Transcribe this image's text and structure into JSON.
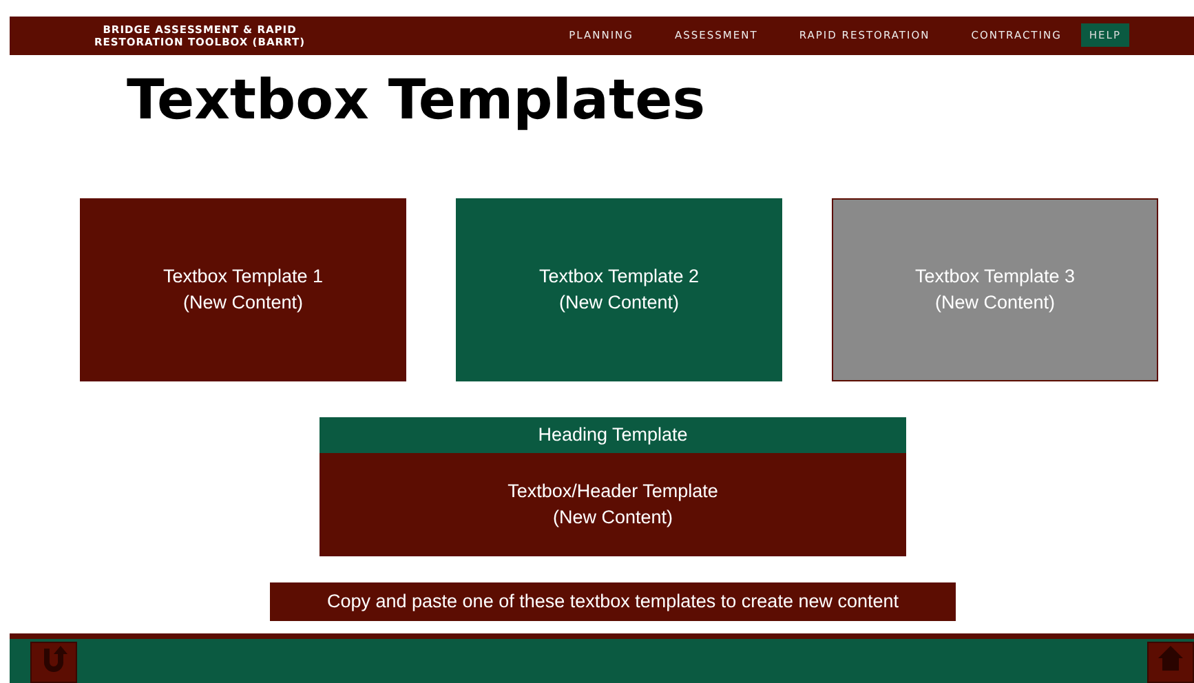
{
  "header": {
    "title_line_1": "BRIDGE ASSESSMENT & RAPID",
    "title_line_2": "RESTORATION TOOLBOX (BARRT)",
    "nav": [
      {
        "label": "PLANNING",
        "kind": "link"
      },
      {
        "label": "ASSESSMENT",
        "kind": "link"
      },
      {
        "label": "RAPID RESTORATION",
        "kind": "link"
      },
      {
        "label": "CONTRACTING",
        "kind": "link"
      },
      {
        "label": "HELP",
        "kind": "button"
      }
    ]
  },
  "page_title": "Textbox Templates",
  "templates": [
    {
      "line_1": "Textbox Template 1",
      "line_2": "(New Content)",
      "color": "#5c0d02"
    },
    {
      "line_1": "Textbox Template 2",
      "line_2": "(New Content)",
      "color": "#0b5a41"
    },
    {
      "line_1": "Textbox Template 3",
      "line_2": "(New Content)",
      "color": "#8a8a8a"
    }
  ],
  "header_template": {
    "heading": "Heading Template",
    "line_1": "Textbox/Header Template",
    "line_2": "(New Content)"
  },
  "instruction": "Copy and paste one of these textbox templates to create new content",
  "footer": {
    "buttons": [
      {
        "kind": "back"
      },
      {
        "kind": "home"
      }
    ]
  }
}
